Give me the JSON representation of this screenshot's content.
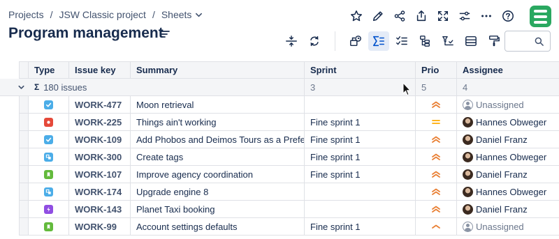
{
  "breadcrumb": {
    "items": [
      "Projects",
      "JSW Classic project",
      "Sheets"
    ],
    "separator": "/"
  },
  "page": {
    "title": "Program management"
  },
  "top_icons": [
    "star-icon",
    "pencil-icon",
    "share-icon",
    "export-icon",
    "fullscreen-icon",
    "settings-sliders-icon",
    "more-icon",
    "help-icon"
  ],
  "toolbar_icons": [
    "row-height-icon",
    "refresh-icon",
    "structure-icon",
    "sum-icon",
    "checklist-icon",
    "hierarchy-icon",
    "filter-tree-icon",
    "rows-icon",
    "format-painter-icon"
  ],
  "grid": {
    "columns": [
      "Type",
      "Issue key",
      "Summary",
      "Sprint",
      "Prio",
      "Assignee"
    ],
    "summary_row": {
      "sigma": "Σ",
      "issues": "180 issues",
      "sprint": "3",
      "prio": "5",
      "assignee": "4"
    },
    "rows": [
      {
        "type": "task",
        "key": "WORK-477",
        "summary": "Moon retrieval",
        "sprint": "",
        "prio": "high",
        "assignee": "Unassigned",
        "avatar": "unassigned"
      },
      {
        "type": "bug",
        "key": "WORK-225",
        "summary": "Things ain't working",
        "sprint": "Fine sprint 1",
        "prio": "medium",
        "assignee": "Hannes Obweger",
        "avatar": "person"
      },
      {
        "type": "task",
        "key": "WORK-109",
        "summary": "Add Phobos and Deimos Tours as a Prefe…",
        "sprint": "Fine sprint 1",
        "prio": "high",
        "assignee": "Daniel Franz",
        "avatar": "person"
      },
      {
        "type": "subtask",
        "key": "WORK-300",
        "summary": "Create tags",
        "sprint": "Fine sprint 1",
        "prio": "high",
        "assignee": "Hannes Obweger",
        "avatar": "person"
      },
      {
        "type": "story",
        "key": "WORK-107",
        "summary": "Improve agency coordination",
        "sprint": "Fine sprint 1",
        "prio": "high",
        "assignee": "Daniel Franz",
        "avatar": "person"
      },
      {
        "type": "subtask",
        "key": "WORK-174",
        "summary": "Upgrade engine 8",
        "sprint": "",
        "prio": "high",
        "assignee": "Hannes Obweger",
        "avatar": "person"
      },
      {
        "type": "epic",
        "key": "WORK-143",
        "summary": "Planet Taxi booking",
        "sprint": "",
        "prio": "high",
        "assignee": "Daniel Franz",
        "avatar": "person"
      },
      {
        "type": "story",
        "key": "WORK-99",
        "summary": "Account settings defaults",
        "sprint": "Fine sprint 1",
        "prio": "low-high",
        "assignee": "Unassigned",
        "avatar": "unassigned"
      }
    ]
  },
  "colors": {
    "brand": "#2aa860",
    "task": "#4bade8",
    "bug": "#e5493a",
    "story": "#63ba3c",
    "epic": "#904ee2",
    "prio_high": "#e97f33",
    "prio_medium": "#ffab00",
    "toolbar_active": "#e4ebf7"
  }
}
